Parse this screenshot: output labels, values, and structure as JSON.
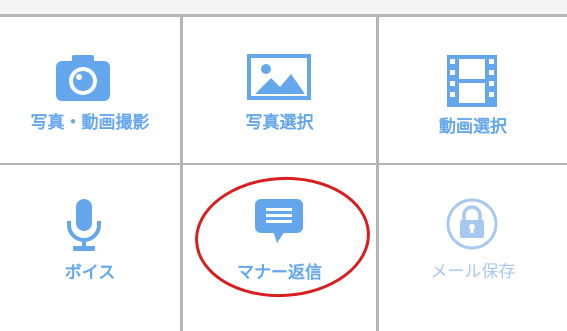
{
  "menu": {
    "items": [
      {
        "label": "写真・動画撮影",
        "icon": "camera-icon"
      },
      {
        "label": "写真選択",
        "icon": "image-icon"
      },
      {
        "label": "動画選択",
        "icon": "film-icon"
      },
      {
        "label": "ボイス",
        "icon": "microphone-icon"
      },
      {
        "label": "マナー返信",
        "icon": "chat-bubble-icon"
      },
      {
        "label": "メール保存",
        "icon": "lock-icon",
        "state": "disabled"
      }
    ]
  },
  "colors": {
    "accent": "#64a7ed",
    "disabled": "#a8c9ef",
    "grid_line": "#b5b5b5",
    "highlight": "#d81e1e"
  }
}
